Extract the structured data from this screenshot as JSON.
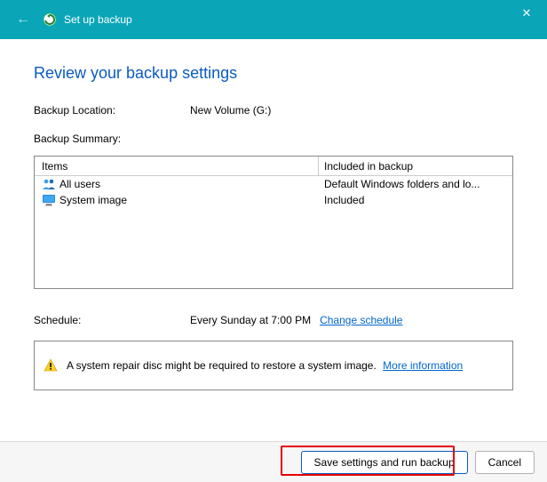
{
  "titlebar": {
    "title": "Set up backup"
  },
  "heading": "Review your backup settings",
  "location": {
    "label": "Backup Location:",
    "value": "New Volume (G:)"
  },
  "summary": {
    "label": "Backup Summary:",
    "columns": {
      "items": "Items",
      "included": "Included in backup"
    },
    "rows": [
      {
        "icon": "users-icon",
        "item": "All users",
        "included": "Default Windows folders and lo..."
      },
      {
        "icon": "monitor-icon",
        "item": "System image",
        "included": "Included"
      }
    ]
  },
  "schedule": {
    "label": "Schedule:",
    "value": "Every Sunday at 7:00 PM",
    "link": "Change schedule"
  },
  "infobox": {
    "text": "A system repair disc might be required to restore a system image.",
    "link": "More information"
  },
  "footer": {
    "primary": "Save settings and run backup",
    "cancel": "Cancel"
  }
}
